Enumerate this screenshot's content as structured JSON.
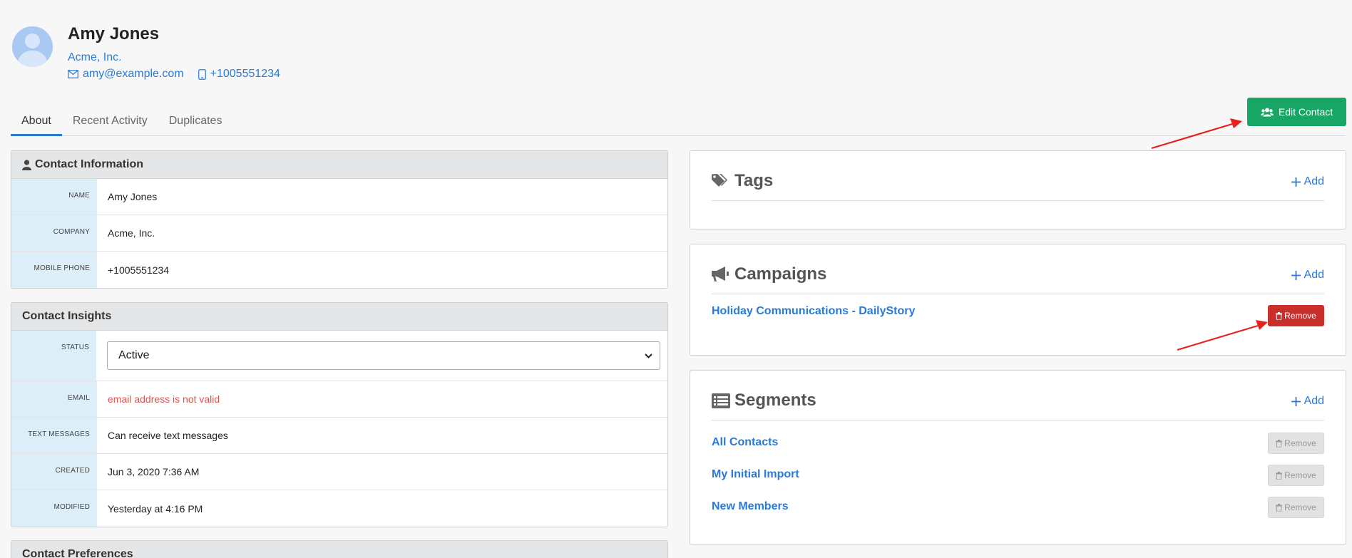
{
  "header": {
    "name": "Amy Jones",
    "company": "Acme, Inc.",
    "email": "amy@example.com",
    "phone": "+1005551234"
  },
  "tabs": [
    {
      "label": "About",
      "active": true
    },
    {
      "label": "Recent Activity",
      "active": false
    },
    {
      "label": "Duplicates",
      "active": false
    }
  ],
  "edit_button": {
    "label": "Edit Contact",
    "icon": "users-icon",
    "color": "#17a666"
  },
  "contact_information": {
    "title": "Contact Information",
    "rows": [
      {
        "label": "Name",
        "value": "Amy Jones"
      },
      {
        "label": "Company",
        "value": "Acme, Inc."
      },
      {
        "label": "Mobile Phone",
        "value": "+1005551234"
      }
    ]
  },
  "contact_insights": {
    "title": "Contact Insights",
    "status_label": "Status",
    "status_value": "Active",
    "rows": [
      {
        "label": "Email",
        "value": "email address is not valid"
      },
      {
        "label": "Text Messages",
        "value": "Can receive text messages"
      },
      {
        "label": "Created",
        "value": "Jun 3, 2020 7:36 AM"
      },
      {
        "label": "Modified",
        "value": "Yesterday at 4:16 PM"
      }
    ]
  },
  "contact_preferences": {
    "title": "Contact Preferences"
  },
  "tags": {
    "title": "Tags",
    "add_label": "Add"
  },
  "campaigns": {
    "title": "Campaigns",
    "add_label": "Add",
    "items": [
      {
        "label": "Holiday Communications - DailyStory",
        "remove_label": "Remove"
      }
    ]
  },
  "segments": {
    "title": "Segments",
    "add_label": "Add",
    "items": [
      {
        "label": "All Contacts",
        "remove_label": "Remove"
      },
      {
        "label": "My Initial Import",
        "remove_label": "Remove"
      },
      {
        "label": "New Members",
        "remove_label": "Remove"
      }
    ]
  },
  "colors": {
    "link": "#2a7ad6",
    "danger": "#c9302c",
    "success": "#17a666",
    "annotation_arrow": "#e8201c"
  }
}
